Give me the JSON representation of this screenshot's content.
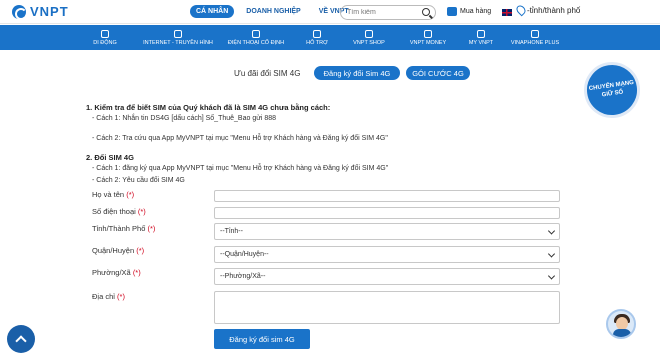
{
  "header": {
    "logo": "VNPT",
    "tabs": [
      "CÁ NHÂN",
      "DOANH NGHIỆP",
      "VỀ VNPT"
    ],
    "search_placeholder": "Tìm kiếm",
    "cart_label": "Mua hàng",
    "location_label": "-tỉnh/thành phố"
  },
  "nav": {
    "items": [
      "DI ĐỘNG",
      "INTERNET - TRUYỀN HÌNH",
      "ĐIỆN THOẠI CỐ ĐỊNH",
      "HỖ TRỢ",
      "VNPT SHOP",
      "VNPT MONEY",
      "MY VNPT",
      "VINAPHONE PLUS"
    ]
  },
  "subtabs": {
    "offer_label": "Ưu đãi đổi SIM 4G",
    "register_label": "Đăng ký đổi Sim 4G",
    "package_label": "GÓI CƯỚC 4G"
  },
  "badge": {
    "text": "CHUYỂN MẠNG GIỮ SỐ"
  },
  "instructions": {
    "section1_title": "1. Kiểm tra để biết SIM của Quý khách đã là SIM 4G chưa bằng cách:",
    "section1_step1": "- Cách 1: Nhắn tin DS4G [dấu cách] Số_Thuê_Bao gửi 888",
    "section1_step2": "- Cách 2: Tra cứu qua App MyVNPT tại mục \"Menu Hỗ trợ Khách hàng và Đăng ký đổi SIM 4G\"",
    "section2_title": "2. Đổi SIM 4G",
    "section2_step1": "- Cách 1: đăng ký qua App MyVNPT tại mục \"Menu Hỗ trợ Khách hàng và Đăng ký đổi SIM 4G\"",
    "section2_step2": "- Cách 2: Yêu cầu đổi SIM 4G"
  },
  "form": {
    "name_label": "Họ và tên",
    "phone_label": "Số điện thoại",
    "province_label": "Tỉnh/Thành Phố",
    "district_label": "Quận/Huyện",
    "ward_label": "Phường/Xã",
    "address_label": "Địa chỉ",
    "required_mark": "(*)",
    "province_value": "--Tỉnh--",
    "district_value": "--Quận/Huyện--",
    "ward_value": "--Phường/Xã--",
    "submit_label": "Đăng ký đổi sim 4G"
  }
}
